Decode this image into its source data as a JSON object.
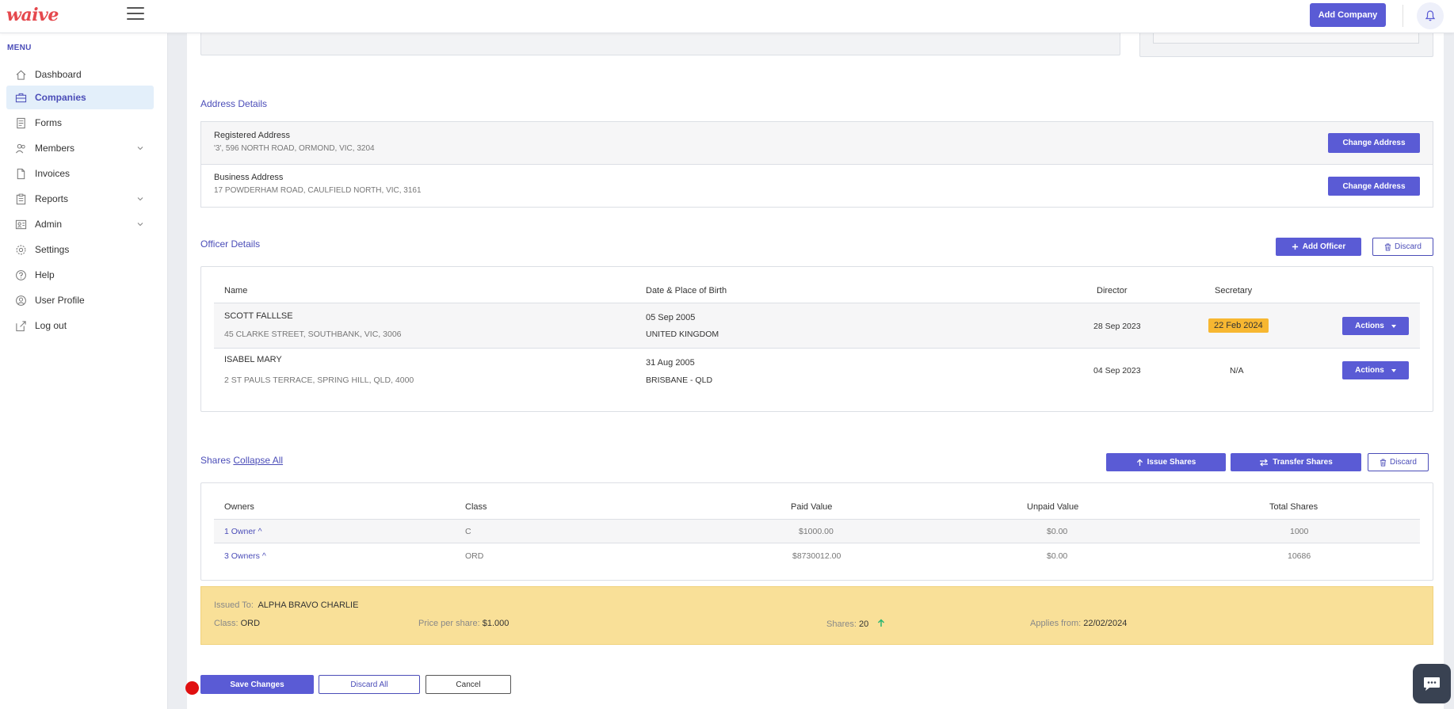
{
  "app": {
    "logo": "waive"
  },
  "header": {
    "add_company": "Add Company"
  },
  "sidebar": {
    "menu_title": "MENU",
    "items": [
      {
        "label": "Dashboard",
        "icon": "home-icon"
      },
      {
        "label": "Companies",
        "icon": "briefcase-icon",
        "active": true
      },
      {
        "label": "Forms",
        "icon": "document-list-icon"
      },
      {
        "label": "Members",
        "icon": "users-icon",
        "has_submenu": true
      },
      {
        "label": "Invoices",
        "icon": "file-icon"
      },
      {
        "label": "Reports",
        "icon": "clipboard-icon",
        "has_submenu": true
      },
      {
        "label": "Admin",
        "icon": "admin-icon",
        "has_submenu": true
      },
      {
        "label": "Settings",
        "icon": "gear-icon"
      },
      {
        "label": "Help",
        "icon": "help-icon"
      },
      {
        "label": "User Profile",
        "icon": "user-circle-icon"
      },
      {
        "label": "Log out",
        "icon": "logout-icon"
      }
    ]
  },
  "address": {
    "title": "Address Details",
    "rows": [
      {
        "title": "Registered Address",
        "value": "'3', 596 NORTH ROAD, ORMOND, VIC, 3204",
        "button": "Change Address"
      },
      {
        "title": "Business Address",
        "value": "17 POWDERHAM ROAD, CAULFIELD NORTH, VIC, 3161",
        "button": "Change Address"
      }
    ]
  },
  "officers": {
    "title": "Officer Details",
    "add_officer": "Add Officer",
    "discard": "Discard",
    "headers": [
      "Name",
      "Date & Place of Birth",
      "Director",
      "Secretary"
    ],
    "rows": [
      {
        "name": "SCOTT FALLLSE",
        "address": "45 CLARKE STREET, SOUTHBANK, VIC, 3006",
        "dob": "05 Sep 2005",
        "pob": "UNITED KINGDOM",
        "director": "28 Sep 2023",
        "secretary": "22 Feb 2024",
        "actions": "Actions"
      },
      {
        "name": "ISABEL MARY",
        "address": "2 ST PAULS TERRACE, SPRING HILL, QLD, 4000",
        "dob": "31 Aug 2005",
        "pob": "BRISBANE - QLD",
        "director": "04 Sep 2023",
        "secretary": "N/A",
        "actions": "Actions"
      }
    ]
  },
  "shares": {
    "title": "Shares",
    "collapse_all": "Collapse All",
    "issue": "Issue Shares",
    "transfer": "Transfer Shares",
    "discard": "Discard",
    "headers": [
      "Owners",
      "Class",
      "Paid Value",
      "Unpaid Value",
      "Total Shares"
    ],
    "rows": [
      {
        "owners": "1 Owner ^",
        "class": "C",
        "paid": "$1000.00",
        "unpaid": "$0.00",
        "total": "1000"
      },
      {
        "owners": "3 Owners ^",
        "class": "ORD",
        "paid": "$8730012.00",
        "unpaid": "$0.00",
        "total": "10686"
      }
    ]
  },
  "issued": {
    "issued_to_label": "Issued To:",
    "issued_to": "ALPHA BRAVO CHARLIE",
    "class_label": "Class:",
    "class": "ORD",
    "price_label": "Price per share:",
    "price": "$1.000",
    "shares_label": "Shares:",
    "shares": "20",
    "applies_label": "Applies from:",
    "applies": "22/02/2024"
  },
  "footer": {
    "save": "Save Changes",
    "discard_all": "Discard All",
    "cancel": "Cancel"
  },
  "colors": {
    "primary": "#5a5bd5",
    "secretary_badge": "#f7b731",
    "issued_panel": "#f9e098",
    "active_nav": "#e3effa"
  }
}
